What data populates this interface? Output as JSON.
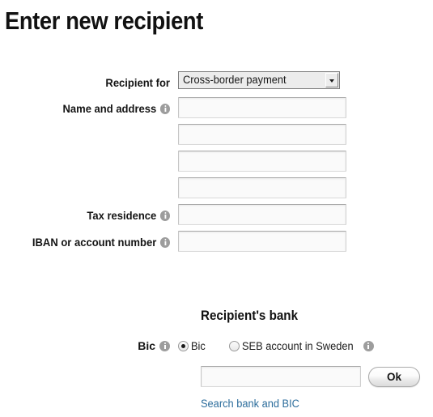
{
  "page": {
    "title": "Enter new recipient"
  },
  "form": {
    "recipient_for": {
      "label": "Recipient for",
      "selected": "Cross-border payment",
      "options": [
        "Cross-border payment"
      ],
      "arrow_icon": "chevron-down-icon"
    },
    "name_and_address": {
      "label": "Name and address",
      "info_icon": "info-icon",
      "lines": [
        {
          "value": "",
          "placeholder": ""
        },
        {
          "value": "",
          "placeholder": ""
        },
        {
          "value": "",
          "placeholder": ""
        },
        {
          "value": "",
          "placeholder": ""
        }
      ]
    },
    "tax_residence": {
      "label": "Tax residence",
      "info_icon": "info-icon",
      "value": "",
      "placeholder": ""
    },
    "iban_or_account_number": {
      "label": "IBAN or account number",
      "info_icon": "info-icon",
      "value": "",
      "placeholder": ""
    }
  },
  "recipients_bank": {
    "heading": "Recipient's bank",
    "bic_row": {
      "label": "Bic",
      "info_icon": "info-icon",
      "options": [
        {
          "label": "Bic",
          "checked": true,
          "has_info_icon": false
        },
        {
          "label": "SEB account in Sweden",
          "checked": false,
          "has_info_icon": true
        }
      ]
    },
    "search_field": {
      "value": "",
      "placeholder": ""
    },
    "ok_button": "Ok",
    "search_link": "Search bank and BIC"
  },
  "colors": {
    "link": "#2c6d9c",
    "text": "#1a1a1a",
    "info_icon": "#9d9d9d",
    "input_background": "#fafafa",
    "select_background": "#ececec",
    "page_background": "#ffffff"
  }
}
